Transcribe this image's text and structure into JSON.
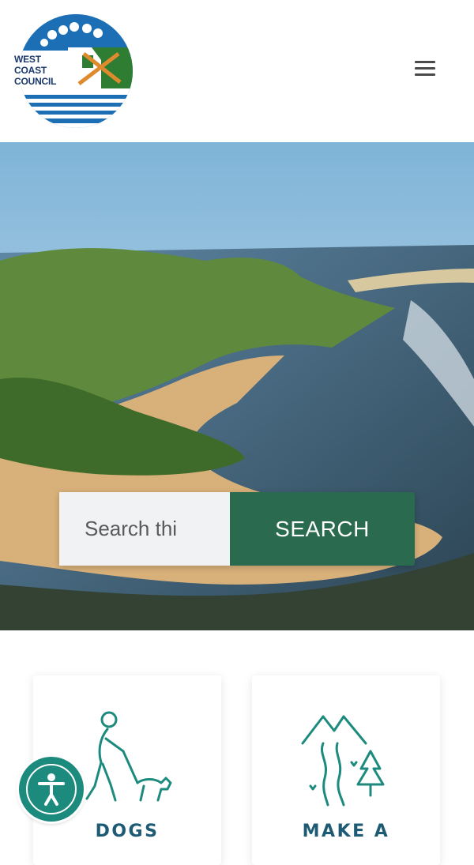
{
  "header": {
    "logo_text": [
      "WEST",
      "COAST",
      "COUNCIL"
    ],
    "menu_icon": "hamburger-menu-icon"
  },
  "search": {
    "placeholder": "Search thi",
    "button_label": "SEARCH"
  },
  "cards": [
    {
      "title": "DOGS",
      "icon": "person-walking-dog-icon"
    },
    {
      "title": "MAKE A",
      "icon": "mountain-road-tree-icon"
    }
  ],
  "accessibility": {
    "icon": "accessibility-person-icon"
  },
  "colors": {
    "brand_green": "#2a6a4e",
    "teal": "#1d8a7e",
    "card_title": "#1d5a73",
    "logo_blue": "#1d6fb5"
  }
}
